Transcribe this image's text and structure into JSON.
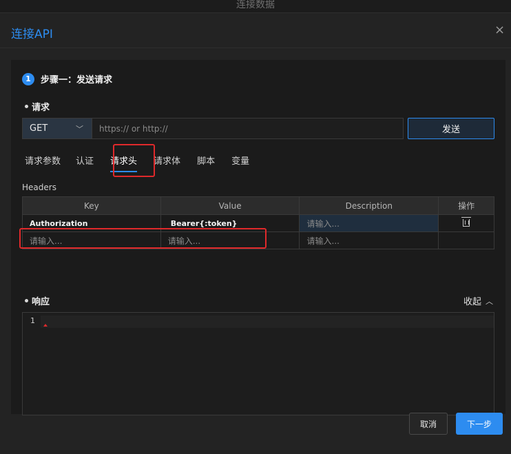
{
  "background_title": "连接数据",
  "dialog": {
    "title": "连接API",
    "close_icon": "close-icon"
  },
  "step": {
    "number": "1",
    "label": "步骤一：发送请求"
  },
  "request": {
    "section_label": "请求",
    "method": "GET",
    "url_placeholder": "https:// or http://",
    "url_value": "",
    "send_label": "发送"
  },
  "tabs": [
    {
      "label": "请求参数",
      "active": false
    },
    {
      "label": "认证",
      "active": false
    },
    {
      "label": "请求头",
      "active": true
    },
    {
      "label": "请求体",
      "active": false
    },
    {
      "label": "脚本",
      "active": false
    },
    {
      "label": "变量",
      "active": false
    }
  ],
  "headers": {
    "label": "Headers",
    "columns": [
      "Key",
      "Value",
      "Description",
      "操作"
    ],
    "rows": [
      {
        "key": "Authorization",
        "value": "Bearer{:token}",
        "description_placeholder": "请输入..."
      },
      {
        "key_placeholder": "请输入...",
        "value_placeholder": "请输入...",
        "description_placeholder": "请输入..."
      }
    ]
  },
  "response": {
    "section_label": "响应",
    "collapse_label": "收起",
    "line_number": "1"
  },
  "footer": {
    "cancel_label": "取消",
    "next_label": "下一步"
  },
  "colors": {
    "accent": "#2d8cf0",
    "highlight": "#e0292b"
  }
}
